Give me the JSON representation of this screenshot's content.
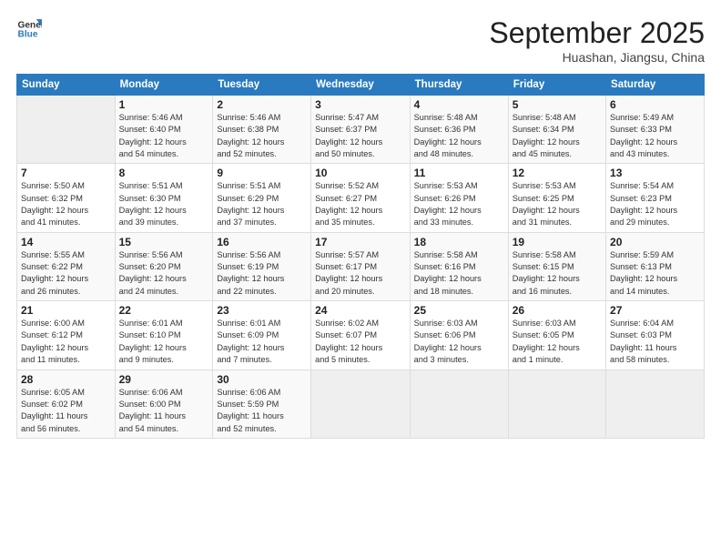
{
  "header": {
    "logo_general": "General",
    "logo_blue": "Blue",
    "month": "September 2025",
    "location": "Huashan, Jiangsu, China"
  },
  "days_of_week": [
    "Sunday",
    "Monday",
    "Tuesday",
    "Wednesday",
    "Thursday",
    "Friday",
    "Saturday"
  ],
  "weeks": [
    [
      {
        "day": "",
        "info": ""
      },
      {
        "day": "1",
        "info": "Sunrise: 5:46 AM\nSunset: 6:40 PM\nDaylight: 12 hours\nand 54 minutes."
      },
      {
        "day": "2",
        "info": "Sunrise: 5:46 AM\nSunset: 6:38 PM\nDaylight: 12 hours\nand 52 minutes."
      },
      {
        "day": "3",
        "info": "Sunrise: 5:47 AM\nSunset: 6:37 PM\nDaylight: 12 hours\nand 50 minutes."
      },
      {
        "day": "4",
        "info": "Sunrise: 5:48 AM\nSunset: 6:36 PM\nDaylight: 12 hours\nand 48 minutes."
      },
      {
        "day": "5",
        "info": "Sunrise: 5:48 AM\nSunset: 6:34 PM\nDaylight: 12 hours\nand 45 minutes."
      },
      {
        "day": "6",
        "info": "Sunrise: 5:49 AM\nSunset: 6:33 PM\nDaylight: 12 hours\nand 43 minutes."
      }
    ],
    [
      {
        "day": "7",
        "info": "Sunrise: 5:50 AM\nSunset: 6:32 PM\nDaylight: 12 hours\nand 41 minutes."
      },
      {
        "day": "8",
        "info": "Sunrise: 5:51 AM\nSunset: 6:30 PM\nDaylight: 12 hours\nand 39 minutes."
      },
      {
        "day": "9",
        "info": "Sunrise: 5:51 AM\nSunset: 6:29 PM\nDaylight: 12 hours\nand 37 minutes."
      },
      {
        "day": "10",
        "info": "Sunrise: 5:52 AM\nSunset: 6:27 PM\nDaylight: 12 hours\nand 35 minutes."
      },
      {
        "day": "11",
        "info": "Sunrise: 5:53 AM\nSunset: 6:26 PM\nDaylight: 12 hours\nand 33 minutes."
      },
      {
        "day": "12",
        "info": "Sunrise: 5:53 AM\nSunset: 6:25 PM\nDaylight: 12 hours\nand 31 minutes."
      },
      {
        "day": "13",
        "info": "Sunrise: 5:54 AM\nSunset: 6:23 PM\nDaylight: 12 hours\nand 29 minutes."
      }
    ],
    [
      {
        "day": "14",
        "info": "Sunrise: 5:55 AM\nSunset: 6:22 PM\nDaylight: 12 hours\nand 26 minutes."
      },
      {
        "day": "15",
        "info": "Sunrise: 5:56 AM\nSunset: 6:20 PM\nDaylight: 12 hours\nand 24 minutes."
      },
      {
        "day": "16",
        "info": "Sunrise: 5:56 AM\nSunset: 6:19 PM\nDaylight: 12 hours\nand 22 minutes."
      },
      {
        "day": "17",
        "info": "Sunrise: 5:57 AM\nSunset: 6:17 PM\nDaylight: 12 hours\nand 20 minutes."
      },
      {
        "day": "18",
        "info": "Sunrise: 5:58 AM\nSunset: 6:16 PM\nDaylight: 12 hours\nand 18 minutes."
      },
      {
        "day": "19",
        "info": "Sunrise: 5:58 AM\nSunset: 6:15 PM\nDaylight: 12 hours\nand 16 minutes."
      },
      {
        "day": "20",
        "info": "Sunrise: 5:59 AM\nSunset: 6:13 PM\nDaylight: 12 hours\nand 14 minutes."
      }
    ],
    [
      {
        "day": "21",
        "info": "Sunrise: 6:00 AM\nSunset: 6:12 PM\nDaylight: 12 hours\nand 11 minutes."
      },
      {
        "day": "22",
        "info": "Sunrise: 6:01 AM\nSunset: 6:10 PM\nDaylight: 12 hours\nand 9 minutes."
      },
      {
        "day": "23",
        "info": "Sunrise: 6:01 AM\nSunset: 6:09 PM\nDaylight: 12 hours\nand 7 minutes."
      },
      {
        "day": "24",
        "info": "Sunrise: 6:02 AM\nSunset: 6:07 PM\nDaylight: 12 hours\nand 5 minutes."
      },
      {
        "day": "25",
        "info": "Sunrise: 6:03 AM\nSunset: 6:06 PM\nDaylight: 12 hours\nand 3 minutes."
      },
      {
        "day": "26",
        "info": "Sunrise: 6:03 AM\nSunset: 6:05 PM\nDaylight: 12 hours\nand 1 minute."
      },
      {
        "day": "27",
        "info": "Sunrise: 6:04 AM\nSunset: 6:03 PM\nDaylight: 11 hours\nand 58 minutes."
      }
    ],
    [
      {
        "day": "28",
        "info": "Sunrise: 6:05 AM\nSunset: 6:02 PM\nDaylight: 11 hours\nand 56 minutes."
      },
      {
        "day": "29",
        "info": "Sunrise: 6:06 AM\nSunset: 6:00 PM\nDaylight: 11 hours\nand 54 minutes."
      },
      {
        "day": "30",
        "info": "Sunrise: 6:06 AM\nSunset: 5:59 PM\nDaylight: 11 hours\nand 52 minutes."
      },
      {
        "day": "",
        "info": ""
      },
      {
        "day": "",
        "info": ""
      },
      {
        "day": "",
        "info": ""
      },
      {
        "day": "",
        "info": ""
      }
    ]
  ]
}
